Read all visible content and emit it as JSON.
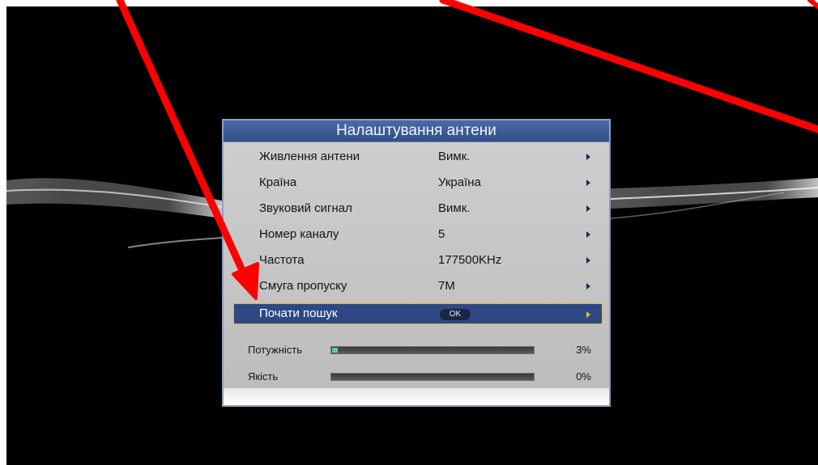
{
  "dialog": {
    "title": "Налаштування антени",
    "menu_items": [
      {
        "label": "Живлення антени",
        "value": "Вимк."
      },
      {
        "label": "Країна",
        "value": "Україна"
      },
      {
        "label": "Звуковий сигнал",
        "value": "Вимк."
      },
      {
        "label": "Номер каналу",
        "value": "5"
      },
      {
        "label": "Частота",
        "value": "177500KHz"
      },
      {
        "label": "Смуга пропуску",
        "value": "7M"
      }
    ],
    "start_search": {
      "label": "Почати пошук",
      "button": "OK"
    },
    "meters": [
      {
        "label": "Потужність",
        "value_text": "3%",
        "percent": 3
      },
      {
        "label": "Якість",
        "value_text": "0%",
        "percent": 0
      }
    ]
  },
  "icons": {
    "menu_arrow": "chevron-right-icon",
    "annotation": "red-arrow-annotation"
  },
  "colors": {
    "title_bar": "#344e86",
    "selected_row": "#2d4884",
    "selected_border": "#d9b04a",
    "panel": "#c6c6c6",
    "meter_fill": "#63c9a6",
    "annotation": "#ff0000"
  }
}
